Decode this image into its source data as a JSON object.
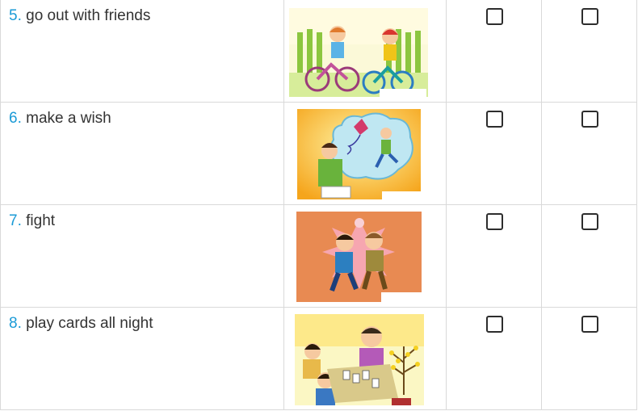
{
  "rows": [
    {
      "num": "5.",
      "text": "go out with friends",
      "image": "children-riding-bicycles-illustration"
    },
    {
      "num": "6.",
      "text": "make a wish",
      "image": "boy-wishing-kite-dream-illustration"
    },
    {
      "num": "7.",
      "text": "fight",
      "image": "two-boys-fighting-illustration"
    },
    {
      "num": "8.",
      "text": "play cards all night",
      "image": "family-playing-cards-illustration"
    }
  ],
  "colors": {
    "number": "#1a9ad6",
    "text": "#333333",
    "border": "#d9d9d9"
  }
}
